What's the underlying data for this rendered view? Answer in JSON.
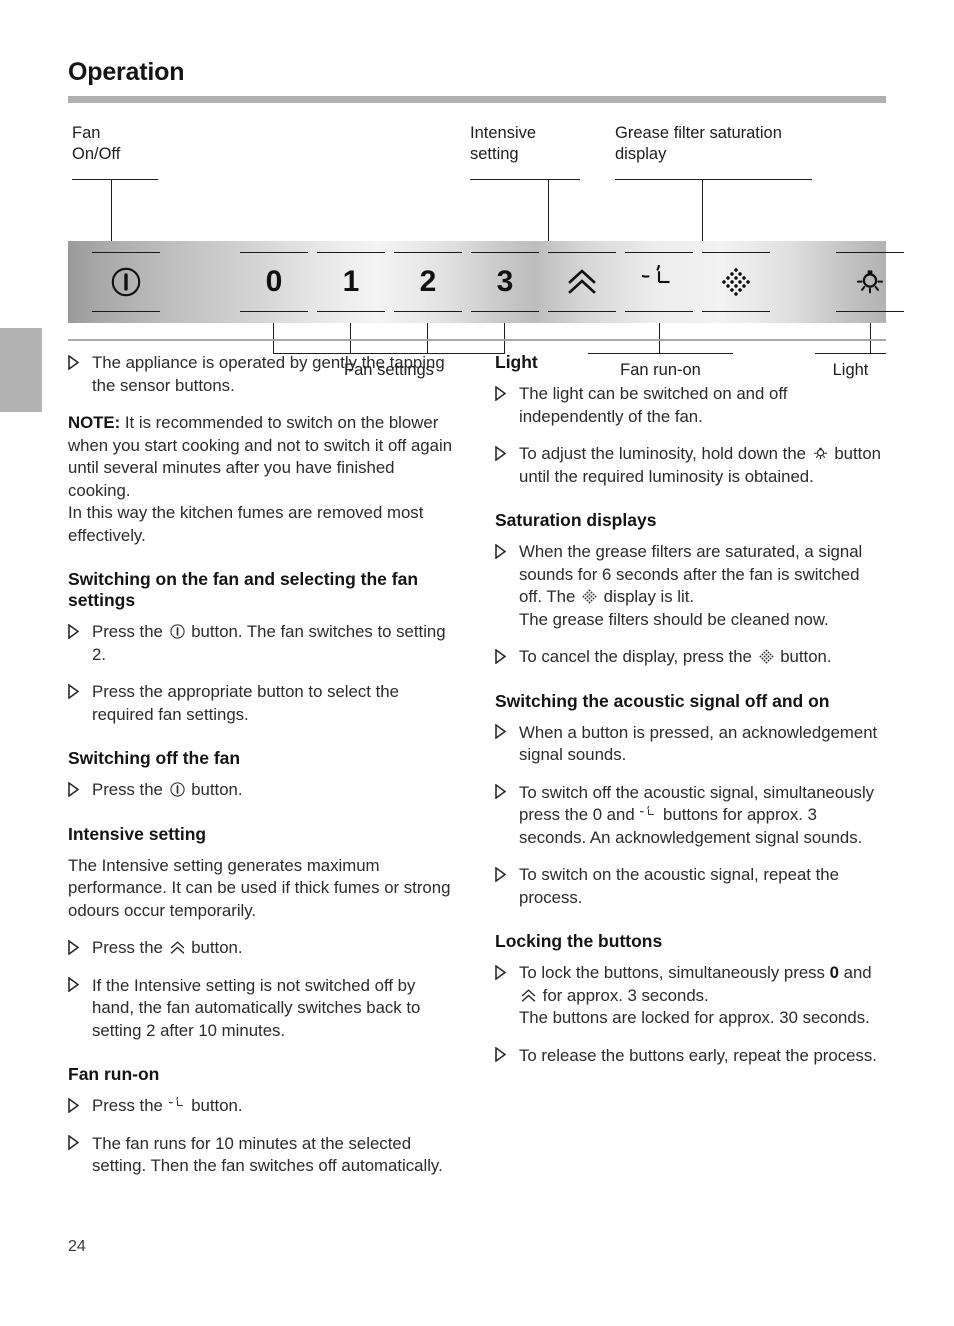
{
  "page": {
    "title": "Operation",
    "number": "24"
  },
  "diagram": {
    "top_callouts": [
      {
        "id": "fan-on-off",
        "label": "Fan\nOn/Off"
      },
      {
        "id": "intensive",
        "label": "Intensive\nsetting"
      },
      {
        "id": "grease-filter",
        "label": "Grease filter saturation\ndisplay"
      }
    ],
    "bottom_callouts": [
      {
        "id": "fan-settings",
        "label": "Fan settings"
      },
      {
        "id": "fan-run-on",
        "label": "Fan run-on"
      },
      {
        "id": "light",
        "label": "Light"
      }
    ],
    "keys": [
      {
        "id": "power",
        "icon": "power-icon",
        "text": ""
      },
      {
        "id": "fan-0",
        "icon": "digit",
        "text": "0"
      },
      {
        "id": "fan-1",
        "icon": "digit",
        "text": "1"
      },
      {
        "id": "fan-2",
        "icon": "digit",
        "text": "2"
      },
      {
        "id": "fan-3",
        "icon": "digit",
        "text": "3"
      },
      {
        "id": "intensive",
        "icon": "double-chevron-up-icon",
        "text": ""
      },
      {
        "id": "run-on",
        "icon": "timer-clock-icon",
        "text": ""
      },
      {
        "id": "grease",
        "icon": "grease-filter-icon",
        "text": ""
      },
      {
        "id": "light",
        "icon": "light-bulb-icon",
        "text": ""
      }
    ]
  },
  "left_column": {
    "intro": "The appliance is operated by gently the tapping the sensor buttons.",
    "note_label": "NOTE:",
    "note_body": " It is recommended to switch on the blower when you start cooking and not to switch it off again until several minutes after you have finished cooking.",
    "note_body2": "In this way the kitchen fumes are removed most effectively.",
    "h_switch_on": "Switching on the fan and selecting the fan settings",
    "switch_on_1a": "Press the ",
    "switch_on_1b": " button. The fan switches to setting 2.",
    "switch_on_2": "Press the appropriate button to select the required fan settings.",
    "h_switch_off": "Switching off the fan",
    "switch_off_1a": "Press the ",
    "switch_off_1b": " button.",
    "h_intensive": "Intensive setting",
    "intensive_p": "The Intensive setting generates maximum performance. It can be used if thick fumes or strong odours occur temporarily.",
    "intensive_1a": "Press the ",
    "intensive_1b": " button.",
    "intensive_2": "If the Intensive setting is not switched off by hand, the fan automatically switches back to setting 2 after 10 minutes.",
    "h_run_on": "Fan run-on",
    "run_on_1a": "Press the ",
    "run_on_1b": " button.",
    "run_on_2": "The fan runs for 10 minutes at the selected setting. Then the fan switches off automatically."
  },
  "right_column": {
    "h_light": "Light",
    "light_1": "The light can be switched on and off independently of the fan.",
    "light_2a": "To adjust the luminosity, hold down the ",
    "light_2b": " button until the required luminosity is obtained.",
    "h_saturation": "Saturation displays",
    "sat_1a": "When the grease filters are saturated, a signal sounds for 6 seconds after the fan is switched off. The ",
    "sat_1b": " display is lit.",
    "sat_1c": "The grease filters should be cleaned now.",
    "sat_2a": "To cancel the display, press the ",
    "sat_2b": " button.",
    "h_acoustic": "Switching the acoustic signal off and on",
    "ac_1": "When a button is pressed, an acknowledgement signal sounds.",
    "ac_2a": "To switch off the acoustic signal, simultaneously press the 0 and ",
    "ac_2b": " buttons for approx. 3 seconds. An acknowledgement signal sounds.",
    "ac_3": "To switch on the acoustic signal, repeat the process.",
    "h_locking": "Locking the buttons",
    "lock_1a": "To lock the buttons, simultaneously press ",
    "lock_1b": "0",
    "lock_1c": " and ",
    "lock_1d": " for approx. 3 seconds.",
    "lock_1e": "The buttons are locked for approx. 30 seconds.",
    "lock_2": "To release the buttons early, repeat the process."
  }
}
